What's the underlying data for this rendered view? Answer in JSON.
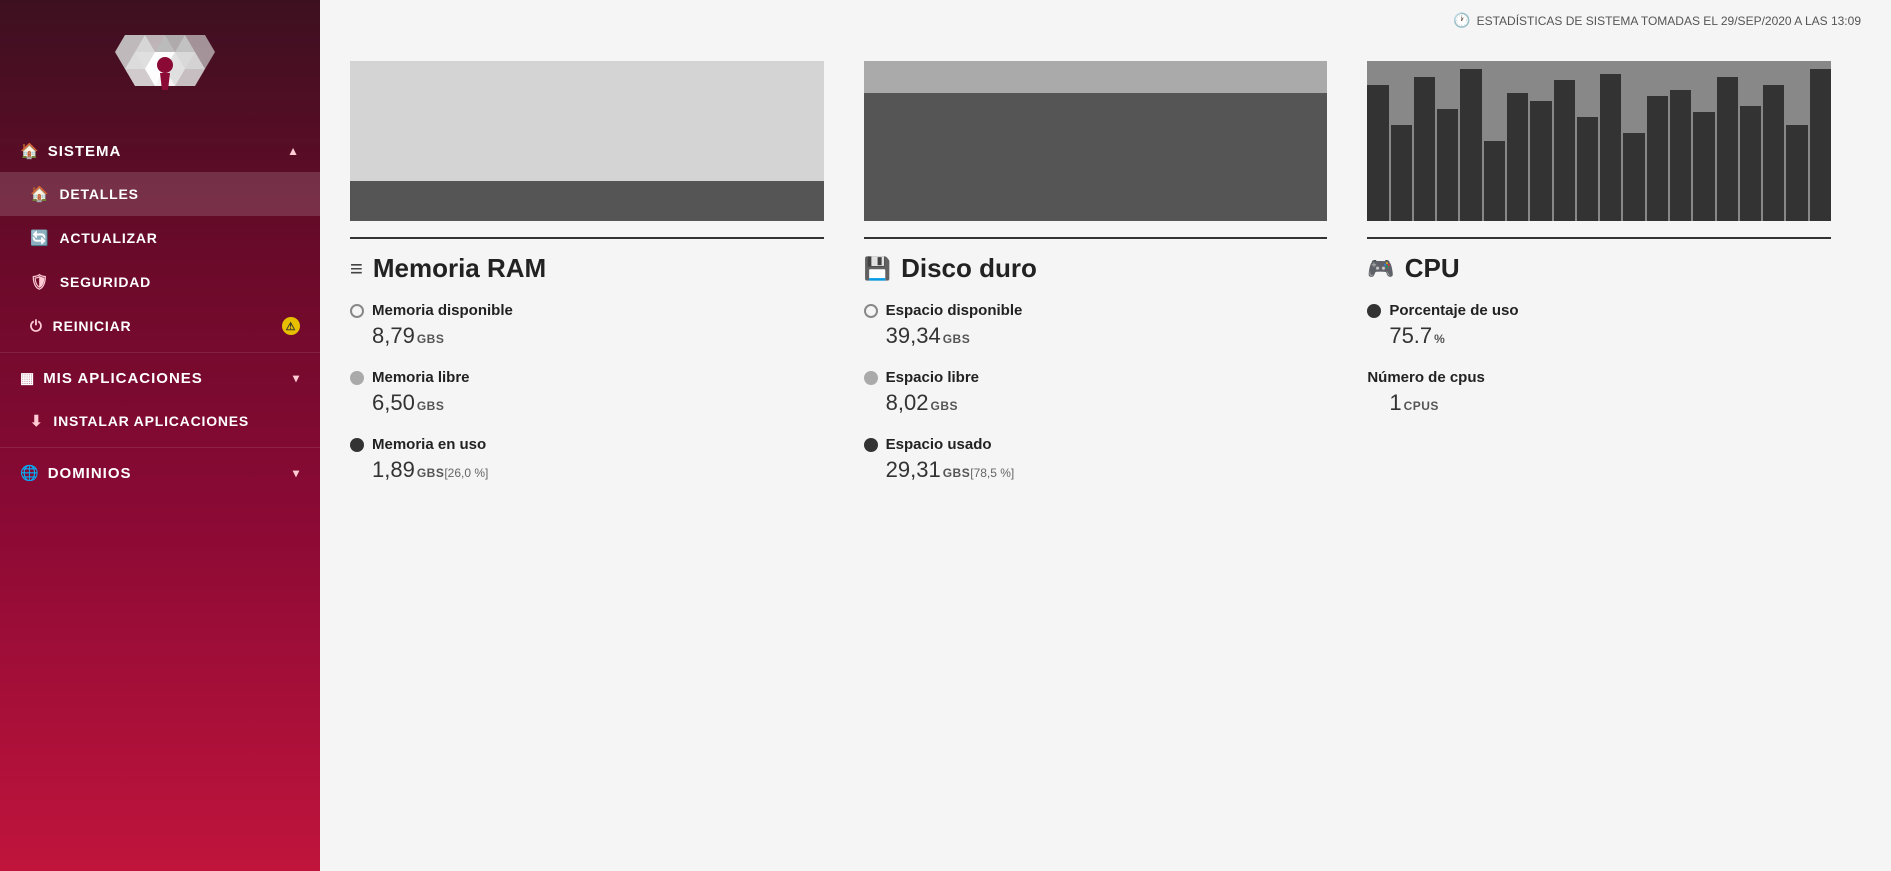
{
  "sidebar": {
    "logo_alt": "System Logo",
    "nav_items": [
      {
        "id": "sistema",
        "label": "SISTEMA",
        "icon": "🏠",
        "chevron": "▲",
        "type": "section",
        "active": true
      },
      {
        "id": "detalles",
        "label": "DETALLES",
        "icon": "🏠",
        "type": "item",
        "active": true
      },
      {
        "id": "actualizar",
        "label": "ACTUALIZAR",
        "icon": "🔄",
        "type": "item"
      },
      {
        "id": "seguridad",
        "label": "SEGURIDAD",
        "icon": "🛡",
        "type": "item"
      },
      {
        "id": "reiniciar",
        "label": "REINICIAR",
        "icon": "⏻",
        "type": "item",
        "badge": "⚠"
      },
      {
        "id": "mis-aplicaciones",
        "label": "MIS APLICACIONES",
        "icon": "▦",
        "chevron": "▾",
        "type": "section"
      },
      {
        "id": "instalar-aplicaciones",
        "label": "INSTALAR APLICACIONES",
        "icon": "⬇",
        "type": "item"
      },
      {
        "id": "dominios",
        "label": "DOMINIOS",
        "icon": "🌐",
        "chevron": "▾",
        "type": "section"
      }
    ]
  },
  "topbar": {
    "timestamp_label": "ESTADÍSTICAS DE SISTEMA TOMADAS EL 29/SEP/2020 A LAS 13:09",
    "clock_icon": "🕐"
  },
  "cards": [
    {
      "id": "ram",
      "title": "Memoria RAM",
      "icon": "≡",
      "metrics": [
        {
          "label": "Memoria disponible",
          "dot_type": "empty",
          "value": "8,79",
          "unit": "GBS",
          "note": ""
        },
        {
          "label": "Memoria libre",
          "dot_type": "gray",
          "value": "6,50",
          "unit": "GBS",
          "note": ""
        },
        {
          "label": "Memoria en uso",
          "dot_type": "dark",
          "value": "1,89",
          "unit": "GBS",
          "note": "[26,0 %]"
        }
      ],
      "chart_type": "ram"
    },
    {
      "id": "disk",
      "title": "Disco duro",
      "icon": "💾",
      "metrics": [
        {
          "label": "Espacio disponible",
          "dot_type": "empty",
          "value": "39,34",
          "unit": "GBS",
          "note": ""
        },
        {
          "label": "Espacio libre",
          "dot_type": "gray",
          "value": "8,02",
          "unit": "GBS",
          "note": ""
        },
        {
          "label": "Espacio usado",
          "dot_type": "dark",
          "value": "29,31",
          "unit": "GBS",
          "note": "[78,5 %]"
        }
      ],
      "chart_type": "disk"
    },
    {
      "id": "cpu",
      "title": "CPU",
      "icon": "🎮",
      "metrics": [
        {
          "label": "Porcentaje de uso",
          "dot_type": "dark",
          "value": "75.7",
          "unit": "%",
          "note": ""
        },
        {
          "label": "Número de cpus",
          "dot_type": "none",
          "value": "1",
          "unit": "CPUS",
          "note": ""
        }
      ],
      "chart_type": "cpu",
      "cpu_bars": [
        85,
        60,
        90,
        70,
        95,
        50,
        80,
        75,
        88,
        65,
        92,
        55,
        78,
        82,
        68,
        90,
        72,
        85,
        60,
        95
      ]
    }
  ]
}
